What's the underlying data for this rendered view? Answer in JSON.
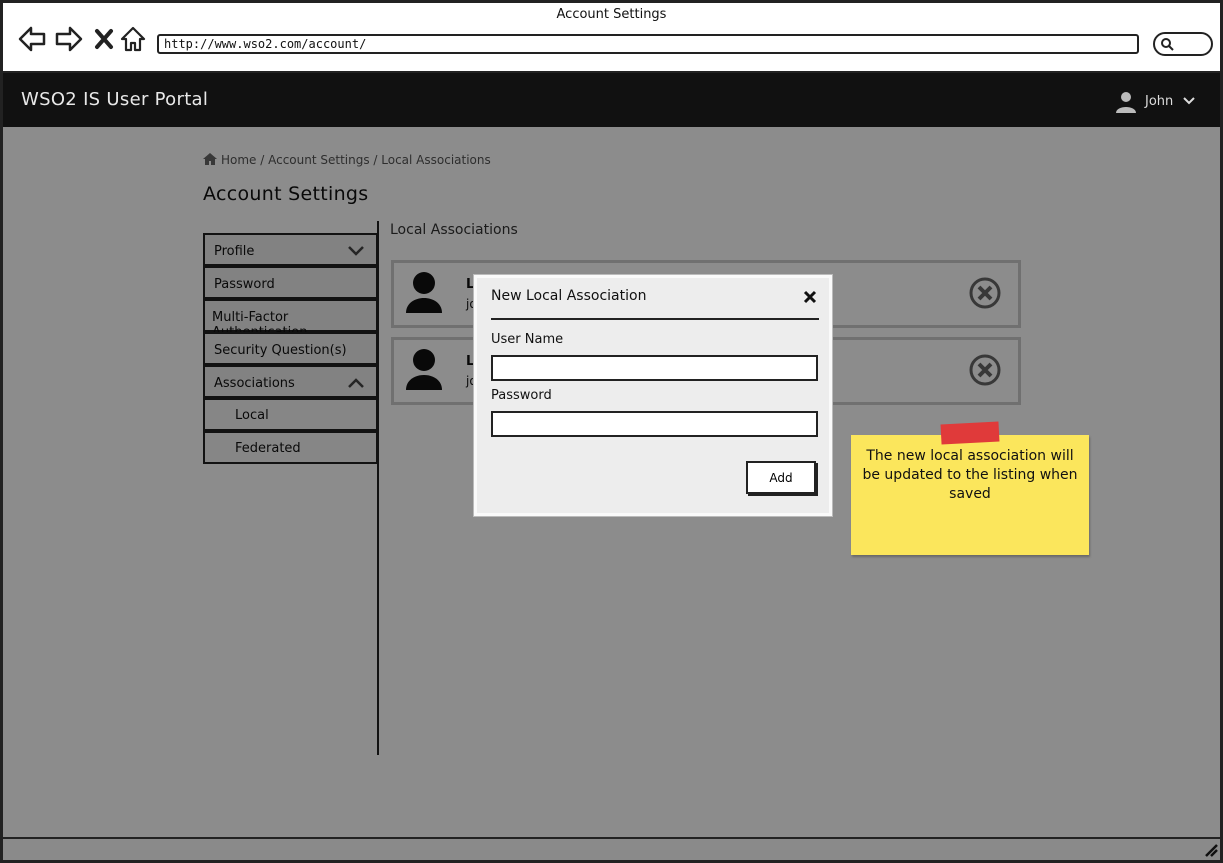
{
  "window": {
    "title": "Account Settings"
  },
  "browser": {
    "url": "http://www.wso2.com/account/"
  },
  "header": {
    "app_title": "WSO2 IS User Portal",
    "user_name": "John"
  },
  "breadcrumb": {
    "text": "Home / Account Settings / Local Associations"
  },
  "page": {
    "title": "Account Settings"
  },
  "sidebar": {
    "items": [
      {
        "label": "Profile"
      },
      {
        "label": "Password"
      },
      {
        "label": "Multi-Factor Authentication"
      },
      {
        "label": "Security Question(s)"
      },
      {
        "label": "Associations"
      }
    ],
    "subitems": [
      {
        "label": "Local"
      },
      {
        "label": "Federated"
      }
    ]
  },
  "content": {
    "section_title": "Local Associations",
    "associations": [
      {
        "line1": "L",
        "line2": "jo"
      },
      {
        "line1": "L",
        "line2": "jo"
      }
    ]
  },
  "modal": {
    "title": "New Local Association",
    "username_label": "User Name",
    "username_value": "",
    "password_label": "Password",
    "password_value": "",
    "add_label": "Add"
  },
  "sticky_note": {
    "text": "The new local association will be updated to the listing when saved"
  },
  "colors": {
    "header_bg": "#111111",
    "sticky": "#fbe65c",
    "tape": "#e03a3a"
  }
}
